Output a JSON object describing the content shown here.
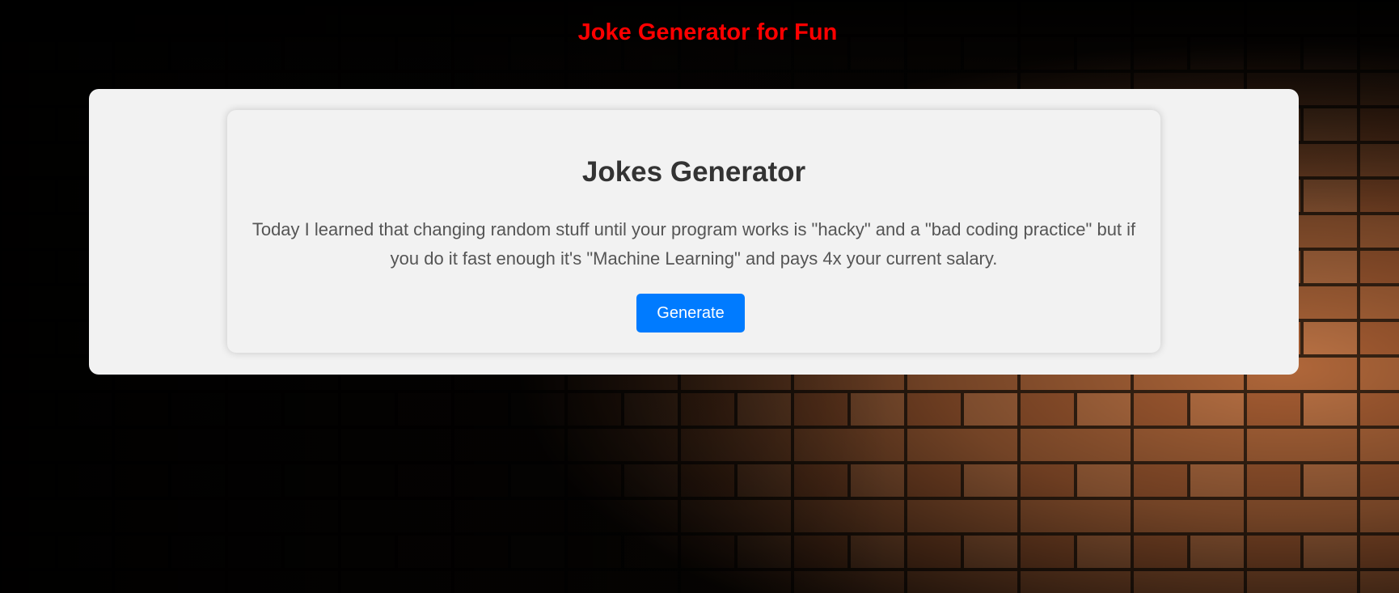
{
  "header": {
    "title": "Joke Generator for Fun"
  },
  "card": {
    "title": "Jokes Generator",
    "joke": "Today I learned that changing random stuff until your program works is \"hacky\" and a \"bad coding practice\" but if you do it fast enough it's \"Machine Learning\" and pays 4x your current salary.",
    "button_label": "Generate"
  },
  "colors": {
    "title_red": "#ff0000",
    "button_blue": "#007bff",
    "panel_bg": "#f2f2f2",
    "heading_text": "#333333",
    "body_text": "#555555"
  },
  "icons": {
    "background": "brick-wall-image"
  }
}
